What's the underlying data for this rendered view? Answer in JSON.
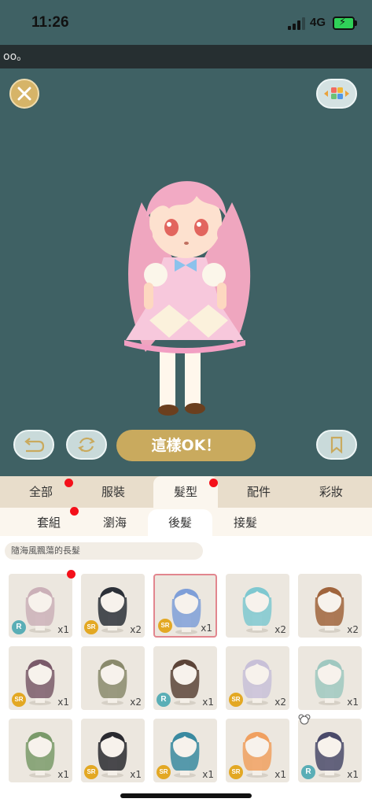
{
  "status_bar": {
    "time": "11:26",
    "network": "4G"
  },
  "ticker": {
    "text": "oo。"
  },
  "stage": {
    "ok_label": "這樣OK！"
  },
  "main_tabs": [
    {
      "label": "全部",
      "active": false,
      "dot": true
    },
    {
      "label": "服裝",
      "active": false,
      "dot": false
    },
    {
      "label": "髮型",
      "active": true,
      "dot": true
    },
    {
      "label": "配件",
      "active": false,
      "dot": false
    },
    {
      "label": "彩妝",
      "active": false,
      "dot": false
    }
  ],
  "sub_tabs": [
    {
      "label": "套組",
      "active": false,
      "dot": true
    },
    {
      "label": "瀏海",
      "active": false,
      "dot": false
    },
    {
      "label": "後髮",
      "active": true,
      "dot": false
    },
    {
      "label": "接髮",
      "active": false,
      "dot": false
    }
  ],
  "item_description": "隨海風飄蕩的長髮",
  "colors": {
    "accent_gold": "#c9aa5e",
    "stage_bg": "#3f6164",
    "new_dot": "#f4101a"
  },
  "items": [
    {
      "rarity": "R",
      "count": "x1",
      "hair": "#cbb0b8",
      "dot": true
    },
    {
      "rarity": "SR",
      "count": "x2",
      "hair": "#2c3038"
    },
    {
      "rarity": "SR",
      "count": "x1",
      "hair": "#7f9fd8",
      "selected": true
    },
    {
      "rarity": "",
      "count": "x2",
      "hair": "#7fc8d0"
    },
    {
      "rarity": "",
      "count": "x2",
      "hair": "#a0643c"
    },
    {
      "rarity": "SR",
      "count": "x1",
      "hair": "#7a5a6a"
    },
    {
      "rarity": "",
      "count": "x2",
      "hair": "#8a8a6c"
    },
    {
      "rarity": "R",
      "count": "x1",
      "hair": "#5c4438"
    },
    {
      "rarity": "SR",
      "count": "x2",
      "hair": "#c8c0d8"
    },
    {
      "rarity": "",
      "count": "x1",
      "hair": "#9fc8c0"
    },
    {
      "rarity": "",
      "count": "x1",
      "hair": "#7a9a6a"
    },
    {
      "rarity": "SR",
      "count": "x1",
      "hair": "#2a2a30"
    },
    {
      "rarity": "SR",
      "count": "x1",
      "hair": "#3a8aa0"
    },
    {
      "rarity": "SR",
      "count": "x1",
      "hair": "#f0a060"
    },
    {
      "rarity": "R",
      "count": "x1",
      "hair": "#4a4a6a",
      "bear_icon": true
    }
  ]
}
